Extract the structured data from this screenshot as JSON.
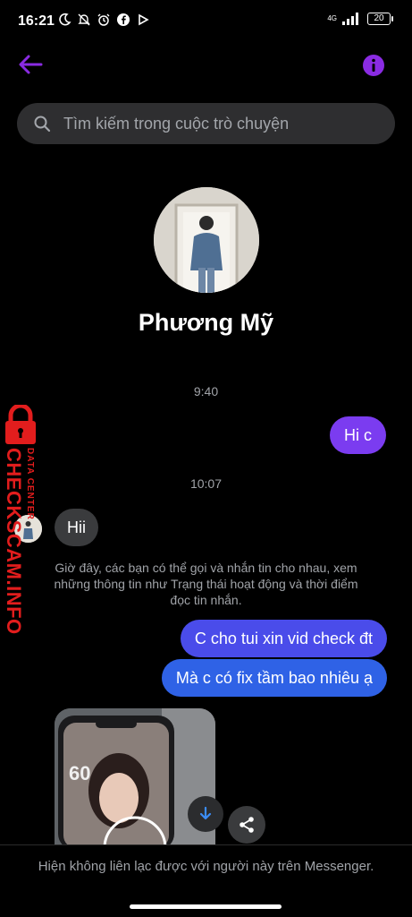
{
  "status_bar": {
    "time": "16:21",
    "network": "4G",
    "battery": "20"
  },
  "top_bar": {
    "back_icon": "arrow-left-icon",
    "info_icon": "info-icon",
    "accent_color": "#8a2be2"
  },
  "search": {
    "placeholder": "Tìm kiếm trong cuộc trò chuyện"
  },
  "profile": {
    "name": "Phương Mỹ"
  },
  "messages": {
    "time_1": "9:40",
    "out_1": "Hi c",
    "time_2": "10:07",
    "in_1": "Hii",
    "notice": "Giờ đây, các bạn có thể gọi và nhắn tin cho nhau, xem những thông tin như Trạng thái hoạt động và thời điểm đọc tin nhắn.",
    "out_2": "C cho tui xin vid check đt",
    "out_3": "Mà c có fix tầm bao nhiêu ạ"
  },
  "footer": {
    "text": "Hiện không liên lạc được với người này trên Messenger."
  },
  "watermark": {
    "main": "CHECKSCAM.INFO",
    "sub": "DATA CENTER"
  },
  "colors": {
    "outgoing_purple": "#7b3cf0",
    "outgoing_blue": "#2f62e6",
    "incoming": "#3a3b3d",
    "watermark_red": "#e21d1d"
  }
}
